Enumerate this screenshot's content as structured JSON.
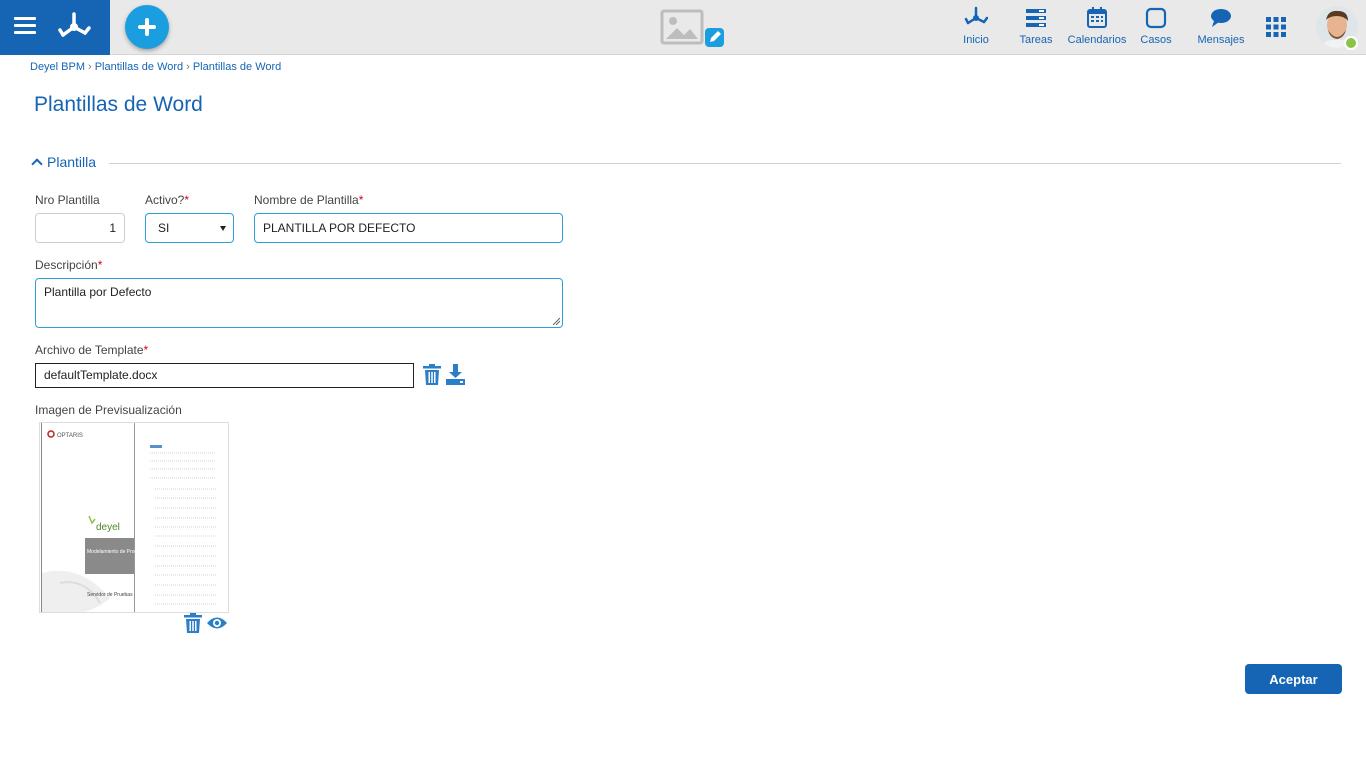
{
  "header": {
    "nav": [
      {
        "label": "Inicio",
        "icon": "home-network-icon"
      },
      {
        "label": "Tareas",
        "icon": "tasks-icon"
      },
      {
        "label": "Calendarios",
        "icon": "calendar-icon"
      },
      {
        "label": "Casos",
        "icon": "cases-icon"
      },
      {
        "label": "Mensajes",
        "icon": "chat-icon"
      }
    ],
    "colors": {
      "brand": "#1565b4",
      "add_button": "#1a9ee0",
      "online": "#8bc34a"
    }
  },
  "breadcrumb": {
    "items": [
      "Deyel BPM",
      "Plantillas de Word",
      "Plantillas de Word"
    ],
    "separator": "›"
  },
  "page": {
    "title": "Plantillas de Word"
  },
  "section": {
    "title": "Plantilla"
  },
  "form": {
    "nro": {
      "label": "Nro Plantilla",
      "value": "1"
    },
    "activo": {
      "label": "Activo?",
      "required": "*",
      "value": "SI"
    },
    "nombre": {
      "label": "Nombre de Plantilla",
      "required": "*",
      "value": "PLANTILLA POR DEFECTO"
    },
    "descripcion": {
      "label": "Descripción",
      "required": "*",
      "value": "Plantilla por Defecto"
    },
    "archivo": {
      "label": "Archivo de Template",
      "required": "*",
      "value": "defaultTemplate.docx"
    },
    "imagen": {
      "label": "Imagen de Previsualización"
    }
  },
  "preview_doc": {
    "company": "OPTARIS",
    "product": "deyel",
    "cover_title": "Modelamiento de Procesos",
    "footer": "Servidor de Pruebas"
  },
  "actions": {
    "accept": "Aceptar"
  }
}
